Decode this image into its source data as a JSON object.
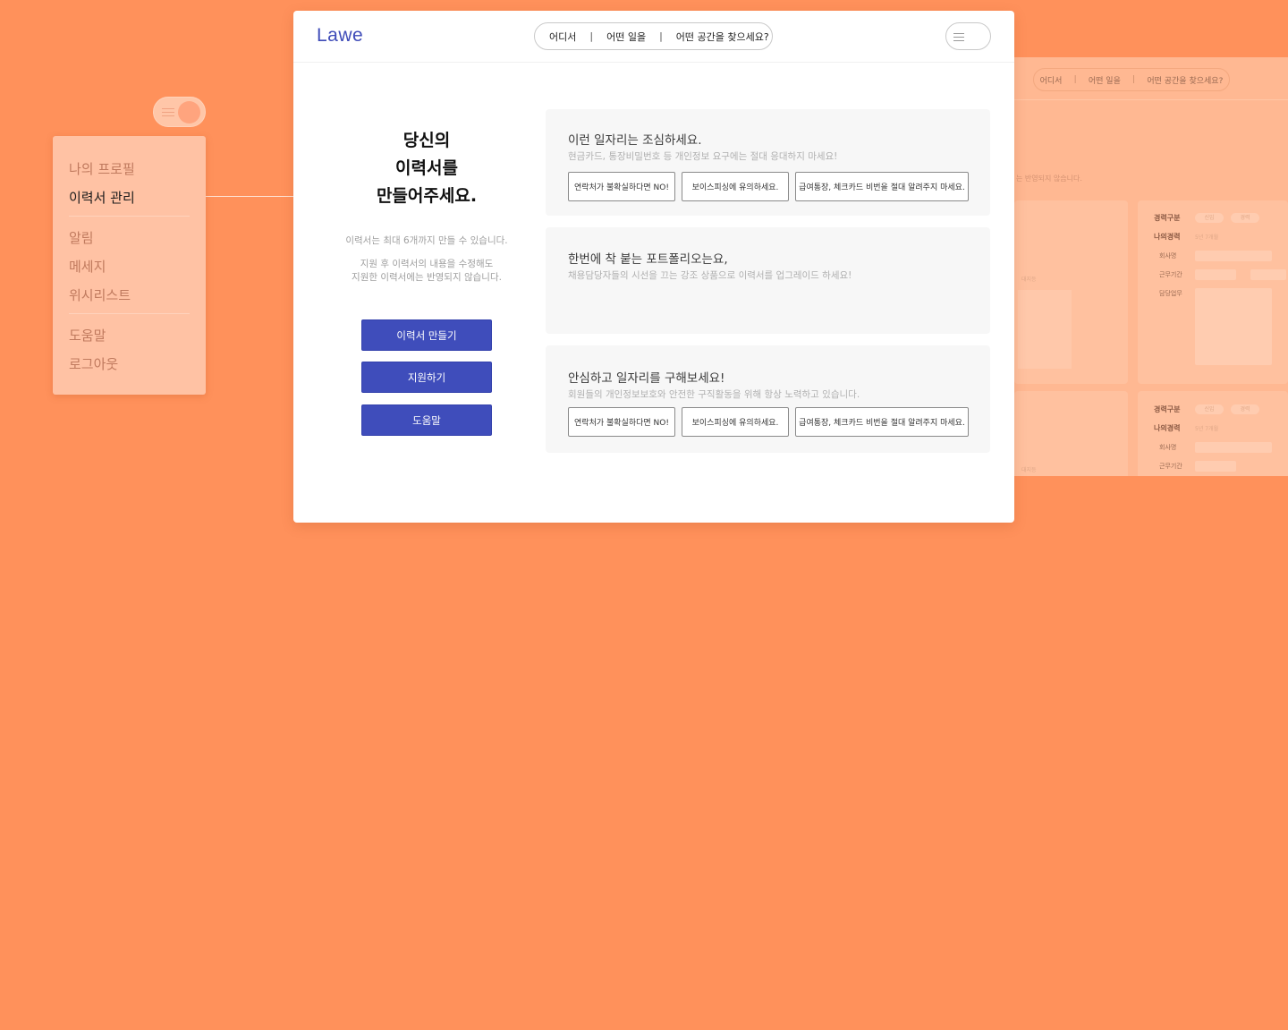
{
  "ghost_page": {
    "search": [
      "어디서",
      "어떤 일을",
      "어떤 공간을 찾으세요?"
    ],
    "note": "는 반영되지 않습니다.",
    "blocks": [
      {
        "rows": [
          {
            "label": "경력구분",
            "chips": [
              "신입",
              "경력"
            ]
          },
          {
            "label": "나의경력",
            "value": "5년 7개월"
          },
          {
            "label": "회사명"
          },
          {
            "label": "근무기간"
          },
          {
            "label": "담당업무"
          }
        ]
      },
      {
        "rows": [
          {
            "label": "경력구분",
            "chips": [
              "신입",
              "경력"
            ]
          },
          {
            "label": "나의경력",
            "value": "5년 7개월"
          },
          {
            "label": "회사명"
          },
          {
            "label": "근무기간"
          }
        ]
      }
    ],
    "left_faint": [
      "대지등",
      "대지등"
    ]
  },
  "side_menu": {
    "items": [
      {
        "label": "나의 프로필",
        "active": false
      },
      {
        "label": "이력서 관리",
        "active": true
      },
      {
        "label": "알림",
        "active": false
      },
      {
        "label": "메세지",
        "active": false
      },
      {
        "label": "위시리스트",
        "active": false
      },
      {
        "label": "도움말",
        "active": false
      },
      {
        "label": "로그아웃",
        "active": false
      }
    ]
  },
  "header": {
    "logo": "Lawe",
    "search": {
      "where": "어디서",
      "what": "어떤 일을",
      "space": "어떤 공간을 찾으세요?",
      "separator": "|"
    }
  },
  "intro": {
    "headline": [
      "당신의",
      "이력서를",
      "만들어주세요."
    ],
    "limit_note": "이력서는 최대 6개까지 만들 수 있습니다.",
    "edit_note": [
      "지원 후 이력서의 내용을 수정해도",
      "지원한 이력서에는 반영되지 않습니다."
    ]
  },
  "actions": {
    "create": "이력서 만들기",
    "apply": "지원하기",
    "help": "도움말"
  },
  "cards": [
    {
      "title": "이런 일자리는 조심하세요.",
      "desc": "현금카드, 통장비밀번호 등 개인정보 요구에는 절대 응대하지 마세요!",
      "chips": [
        "연락처가 불확실하다면 NO!",
        "보이스피싱에 유의하세요.",
        "급여통장, 체크카드 비번을 절대 알려주지 마세요."
      ]
    },
    {
      "title": "한번에 착 붙는 포트폴리오는요,",
      "desc": "채용담당자들의 시선을 끄는 강조 상품으로 이력서를 업그레이드 하세요!",
      "chips": []
    },
    {
      "title": "안심하고 일자리를 구해보세요!",
      "desc": "회원들의 개인정보보호와 안전한 구직활동을 위해 항상 노력하고 있습니다.",
      "chips": [
        "연락처가 불확실하다면 NO!",
        "보이스피싱에 유의하세요.",
        "급여통장, 체크카드 비번을 절대 알려주지 마세요."
      ]
    }
  ],
  "colors": {
    "background": "#ff915b",
    "brand": "#3e4bb8",
    "button": "#3f4dbb",
    "menu_panel": "#ffc2a4"
  }
}
